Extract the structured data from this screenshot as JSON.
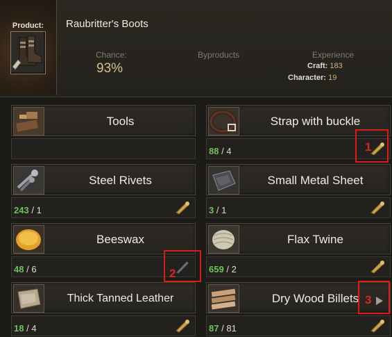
{
  "product": {
    "label": "Product:",
    "name": "Raubritter's Boots",
    "icon": "boots-icon"
  },
  "stats": {
    "chance_label": "Chance:",
    "chance_value": "93%",
    "byproducts_label": "Byproducts",
    "experience_label": "Experience",
    "craft_label": "Craft:",
    "craft_value": "183",
    "character_label": "Character:",
    "character_value": "19"
  },
  "ingredients": [
    {
      "name": "Tools",
      "have": "",
      "sep": "",
      "need": "",
      "icon": "tools-icon",
      "action": "none"
    },
    {
      "name": "Strap with buckle",
      "have": "88",
      "sep": "/",
      "need": "4",
      "icon": "strap-icon",
      "action": "scroll-icon"
    },
    {
      "name": "Steel Rivets",
      "have": "243",
      "sep": "/",
      "need": "1",
      "icon": "rivets-icon",
      "action": "scroll-icon"
    },
    {
      "name": "Small Metal Sheet",
      "have": "3",
      "sep": "/",
      "need": "1",
      "icon": "metal-sheet-icon",
      "action": "scroll-icon"
    },
    {
      "name": "Beeswax",
      "have": "48",
      "sep": "/",
      "need": "6",
      "icon": "beeswax-icon",
      "action": "knife-icon"
    },
    {
      "name": "Flax Twine",
      "have": "659",
      "sep": "/",
      "need": "2",
      "icon": "twine-icon",
      "action": "scroll-icon"
    },
    {
      "name": "Thick Tanned Leather",
      "have": "18",
      "sep": "/",
      "need": "4",
      "icon": "leather-icon",
      "action": "scroll-icon"
    },
    {
      "name": "Dry Wood Billets",
      "have": "87",
      "sep": "/",
      "need": "81",
      "icon": "wood-icon",
      "action": "scroll-icon"
    }
  ],
  "markers": [
    "1",
    "2",
    "3"
  ],
  "colors": {
    "have_count": "#6fc25a",
    "chance": "#d8c08a",
    "marker": "#e01818"
  }
}
